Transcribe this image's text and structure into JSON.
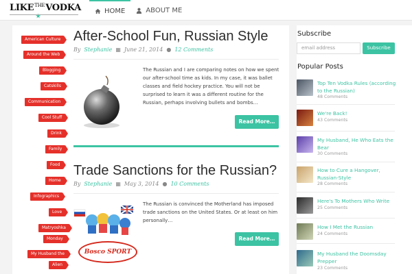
{
  "header": {
    "logo": {
      "part1": "LIKE",
      "part2": "THE",
      "part3": "VODKA"
    },
    "nav": [
      {
        "label": "HOME",
        "icon": "home-icon",
        "active": true
      },
      {
        "label": "ABOUT ME",
        "icon": "user-icon",
        "active": false
      }
    ]
  },
  "colors": {
    "accent": "#3cc3a3",
    "tag": "#e5302a"
  },
  "categories": [
    "American Culture",
    "Around the Web",
    "Blogging",
    "Catskills",
    "Communication",
    "Cool Stuff",
    "Drink",
    "Family",
    "Food",
    "Home",
    "Infographics",
    "Love",
    "Matryoshka",
    "Monday",
    "My Husband the",
    "Alien"
  ],
  "posts": [
    {
      "title": "After-School Fun, Russian Style",
      "by": "By",
      "author": "Stephanie",
      "date": "June 21, 2014",
      "comments": "12 Comments",
      "excerpt": "The Russian and I are comparing notes on how we spent our after-school time as kids. In my case, it was ballet classes and field hockey practice. You will not be surprised to learn it was a different routine for the Russian, perhaps involving bullets and bombs…",
      "read_more": "Read More…",
      "image": "bomb-image"
    },
    {
      "title": "Trade Sanctions for the Russian?",
      "by": "By",
      "author": "Stephanie",
      "date": "May 3, 2014",
      "comments": "10 Comments",
      "excerpt": "The Russian is convinced the Motherland has imposed trade sanctions on the United States. Or at least on him personally…",
      "read_more": "Read More…",
      "image": "bosco-sport-image",
      "image_text": "Bosco SPORT"
    }
  ],
  "sidebar": {
    "subscribe_heading": "Subscribe",
    "email_placeholder": "email address",
    "subscribe_button": "Subscribe",
    "popular_heading": "Popular Posts",
    "popular": [
      {
        "title": "Top Ten Vodka Rules (according to the Russian)",
        "comments": "48 Comments"
      },
      {
        "title": "We're Back!",
        "comments": "43 Comments"
      },
      {
        "title": "My Husband, He Who Eats the Bear",
        "comments": "30 Comments"
      },
      {
        "title": "How to Cure a Hangover, Russian-Style",
        "comments": "28 Comments"
      },
      {
        "title": "Here's To Mothers Who Write",
        "comments": "25 Comments"
      },
      {
        "title": "How I Met the Russian",
        "comments": "24 Comments"
      },
      {
        "title": "My Husband the Doomsday Prepper",
        "comments": "23 Comments"
      }
    ]
  }
}
